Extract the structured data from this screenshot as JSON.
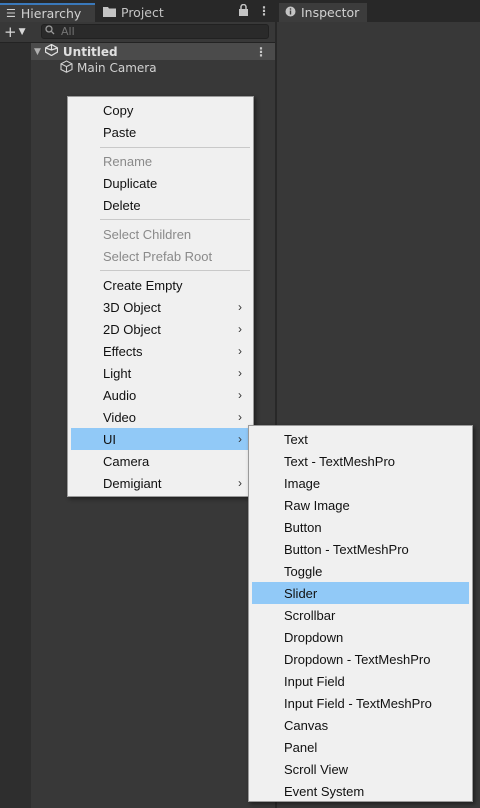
{
  "tabs": {
    "hierarchy": "Hierarchy",
    "project": "Project",
    "inspector": "Inspector"
  },
  "toolbar": {
    "add_symbol": "+",
    "search_placeholder": "All"
  },
  "hierarchy": {
    "scene": "Untitled",
    "objects": [
      "Main Camera"
    ]
  },
  "context_menu": {
    "copy": "Copy",
    "paste": "Paste",
    "rename": "Rename",
    "duplicate": "Duplicate",
    "delete": "Delete",
    "select_children": "Select Children",
    "select_prefab_root": "Select Prefab Root",
    "create_empty": "Create Empty",
    "object_3d": "3D Object",
    "object_2d": "2D Object",
    "effects": "Effects",
    "light": "Light",
    "audio": "Audio",
    "video": "Video",
    "ui": "UI",
    "camera": "Camera",
    "demigiant": "Demigiant"
  },
  "ui_submenu": {
    "items": [
      "Text",
      "Text - TextMeshPro",
      "Image",
      "Raw Image",
      "Button",
      "Button - TextMeshPro",
      "Toggle",
      "Slider",
      "Scrollbar",
      "Dropdown",
      "Dropdown - TextMeshPro",
      "Input Field",
      "Input Field - TextMeshPro",
      "Canvas",
      "Panel",
      "Scroll View",
      "Event System"
    ],
    "highlighted": "Slider"
  },
  "colors": {
    "menu_background": "#f0f0f0",
    "menu_highlight": "#91c9f7",
    "panel_background": "#383838",
    "active_tab_accent": "#3a79bb"
  },
  "icons": {
    "hierarchy_tab": "list-icon",
    "project_tab": "folder-icon",
    "inspector_tab": "info-icon",
    "scene": "unity-scene-icon",
    "camera_object": "cube-icon",
    "lock": "lock-icon",
    "more": "kebab-menu-icon",
    "search": "search-icon",
    "submenu": "chevron-right-icon"
  }
}
